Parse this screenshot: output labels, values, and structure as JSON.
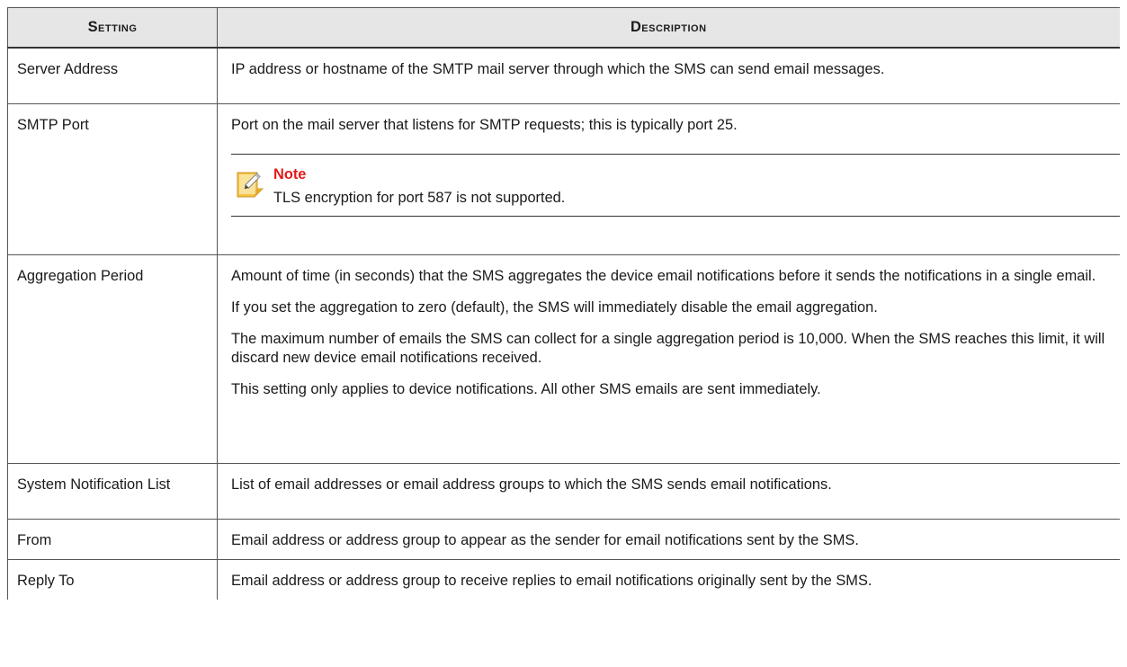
{
  "headers": {
    "setting": "Setting",
    "description": "Description"
  },
  "rows": [
    {
      "setting": "Server Address",
      "paragraphs": [
        "IP address or hostname of the SMTP mail server through which the SMS can send email messages."
      ]
    },
    {
      "setting": "SMTP Port",
      "paragraphs": [
        "Port on the mail server that listens for SMTP requests; this is typically port 25."
      ],
      "note": {
        "title": "Note",
        "text": "TLS encryption for port 587 is not supported.",
        "icon": "note-pencil-icon",
        "title_color": "#e31b1b",
        "icon_color": "#f5c242"
      }
    },
    {
      "setting": "Aggregation Period",
      "paragraphs": [
        "Amount of time (in seconds) that the SMS aggregates the device email notifications before it sends the notifications in a single email.",
        "If you set the aggregation to zero (default), the SMS will immediately disable the email aggregation.",
        "The maximum number of emails the SMS can collect for a single aggregation period is 10,000. When the SMS reaches this limit, it will discard new device email notifications received.",
        "This setting only applies to device notifications. All other SMS emails are sent immediately."
      ]
    },
    {
      "setting": "System Notification List",
      "paragraphs": [
        "List of email addresses or email address groups to which the SMS sends email notifications."
      ]
    },
    {
      "setting": "From",
      "paragraphs": [
        "Email address or address group to appear as the sender for email notifications sent by the SMS."
      ]
    },
    {
      "setting": "Reply To",
      "paragraphs": [
        "Email address or address group to receive replies to email notifications originally sent by the SMS."
      ]
    }
  ]
}
